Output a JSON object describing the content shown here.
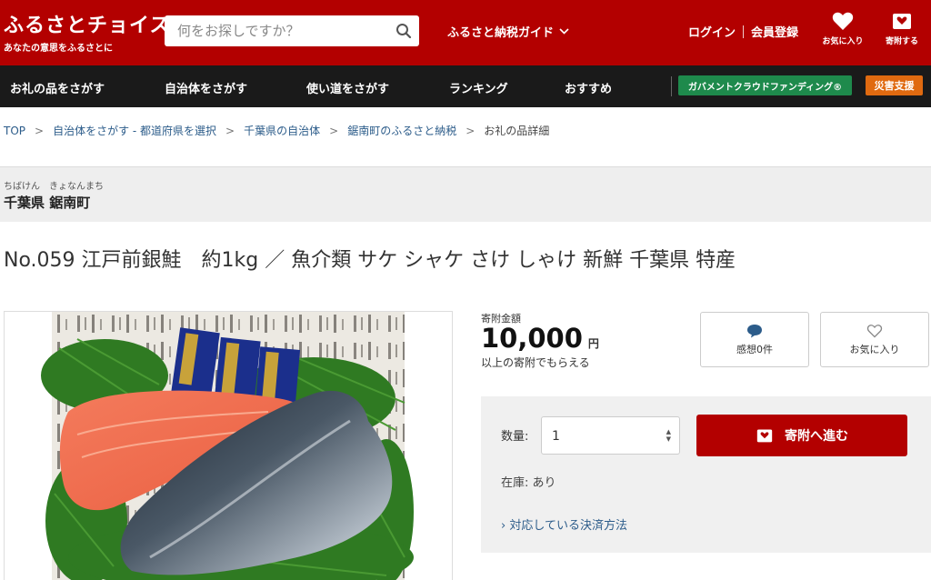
{
  "header": {
    "logo_main": "ふるさとチョイス",
    "logo_sub": "あなたの意思をふるさとに",
    "search_placeholder": "何をお探しですか？",
    "guide_label": "ふるさと納税ガイド",
    "login_label": "ログイン",
    "register_label": "会員登録",
    "favorites_label": "お気に入り",
    "donation_list_label": "寄附する"
  },
  "nav": {
    "items": [
      "お礼の品をさがす",
      "自治体をさがす",
      "使い道をさがす",
      "ランキング",
      "おすすめ"
    ],
    "gcf_label": "ガバメントクラウドファンディング®",
    "disaster_label": "災害支援"
  },
  "breadcrumb": {
    "items": [
      "TOP",
      "自治体をさがす - 都道府県を選択",
      "千葉県の自治体",
      "鋸南町のふるさと納税"
    ],
    "current": "お礼の品詳細"
  },
  "municipality": {
    "ruby": "ちばけん　きょなんまち",
    "name": "千葉県 鋸南町"
  },
  "product": {
    "title": "No.059 江戸前銀鮭　約1kg ／ 魚介類 サケ シャケ さけ しゃけ 新鮮 千葉県 特産",
    "package_text": "江戸前銀鮭"
  },
  "donation": {
    "amount_label": "寄附金額",
    "amount": "10,000",
    "currency": "円",
    "note": "以上の寄附でもらえる",
    "review_label": "感想0件",
    "favorite_label": "お気に入り",
    "quantity_label": "数量:",
    "quantity_value": "1",
    "submit_label": "寄附へ進む",
    "stock_label": "在庫: あり",
    "payment_link": "› 対応している決済方法"
  },
  "colors": {
    "brand_red": "#b30000",
    "nav_dark": "#1a1a1a",
    "gcf_green": "#1e8a4c",
    "disaster_orange": "#e06a10",
    "link_blue": "#2c5c8a"
  }
}
